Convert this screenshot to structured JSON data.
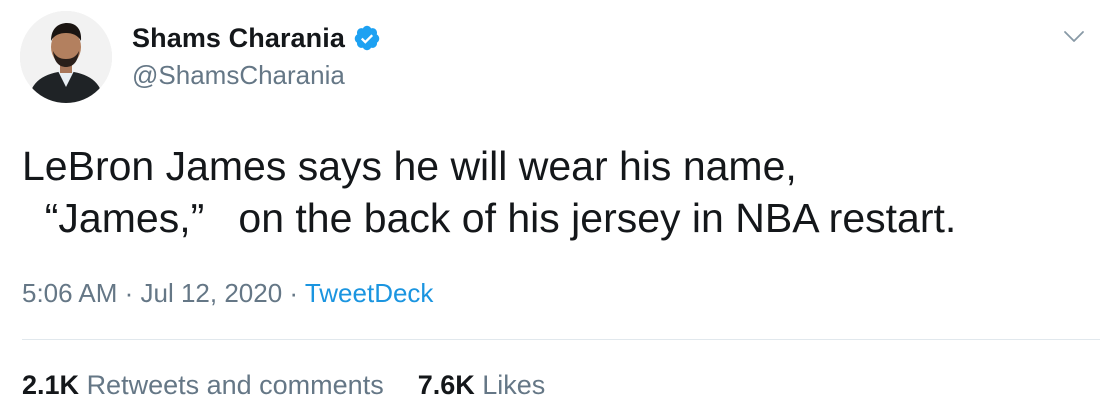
{
  "user": {
    "display_name": "Shams Charania",
    "handle": "@ShamsCharania",
    "verified": true
  },
  "icons": {
    "avatar": "profile-photo",
    "verified": "verified-badge-icon",
    "menu": "chevron-down-icon"
  },
  "tweet": {
    "line1": "LeBron James says he will wear his name,",
    "line2": "  “James,”   on the back of his jersey in NBA restart."
  },
  "meta": {
    "time": "5:06 AM",
    "sep1": " · ",
    "date": "Jul 12, 2020",
    "sep2": " · ",
    "source": "TweetDeck"
  },
  "stats": {
    "retweets_count": "2.1K",
    "retweets_label": "Retweets and comments",
    "likes_count": "7.6K",
    "likes_label": "Likes"
  },
  "colors": {
    "accent": "#1b95e0",
    "secondary_text": "#657786",
    "primary_text": "#14171a",
    "divider": "#e1e8ed"
  }
}
